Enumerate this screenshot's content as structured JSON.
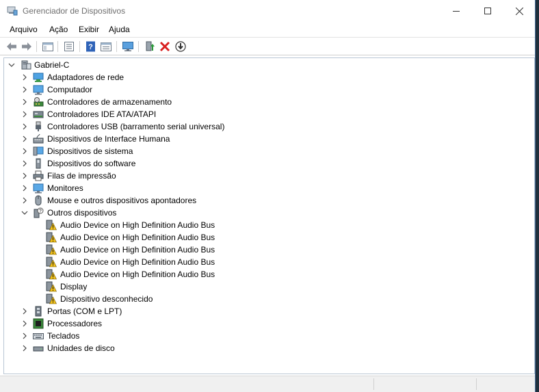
{
  "window": {
    "title": "Gerenciador de Dispositivos",
    "controls": {
      "minimize": "—",
      "maximize": "☐",
      "close": "✕"
    }
  },
  "menu": [
    "Arquivo",
    "Ação",
    "Exibir",
    "Ajuda"
  ],
  "toolbar": {
    "buttons": [
      "back-icon",
      "forward-icon",
      "properties-pane-icon",
      "properties-list-icon",
      "help-icon",
      "view-details-icon",
      "monitor-scan-icon",
      "update-driver-icon",
      "uninstall-icon",
      "disable-icon"
    ],
    "accent_colors": {
      "uninstall": "#d92020",
      "update": "#2a9a3a",
      "help": "#2f63b8"
    }
  },
  "tree": {
    "root": "Gabriel-C",
    "categories": [
      {
        "label": "Adaptadores de rede",
        "icon": "network-adapter-icon",
        "expanded": false
      },
      {
        "label": "Computador",
        "icon": "computer-icon",
        "expanded": false
      },
      {
        "label": "Controladores de armazenamento",
        "icon": "storage-controller-icon",
        "expanded": false
      },
      {
        "label": "Controladores IDE ATA/ATAPI",
        "icon": "ide-controller-icon",
        "expanded": false
      },
      {
        "label": "Controladores USB (barramento serial universal)",
        "icon": "usb-icon",
        "expanded": false
      },
      {
        "label": "Dispositivos de Interface Humana",
        "icon": "hid-icon",
        "expanded": false
      },
      {
        "label": "Dispositivos de sistema",
        "icon": "system-device-icon",
        "expanded": false
      },
      {
        "label": "Dispositivos do software",
        "icon": "software-device-icon",
        "expanded": false
      },
      {
        "label": "Filas de impressão",
        "icon": "printer-icon",
        "expanded": false
      },
      {
        "label": "Monitores",
        "icon": "monitor-icon",
        "expanded": false
      },
      {
        "label": "Mouse e outros dispositivos apontadores",
        "icon": "mouse-icon",
        "expanded": false
      },
      {
        "label": "Outros dispositivos",
        "icon": "other-devices-icon",
        "expanded": true,
        "children": [
          "Audio Device on High Definition Audio Bus",
          "Audio Device on High Definition Audio Bus",
          "Audio Device on High Definition Audio Bus",
          "Audio Device on High Definition Audio Bus",
          "Audio Device on High Definition Audio Bus",
          "Display",
          "Dispositivo desconhecido"
        ]
      },
      {
        "label": "Portas (COM e LPT)",
        "icon": "port-icon",
        "expanded": false
      },
      {
        "label": "Processadores",
        "icon": "processor-icon",
        "expanded": false
      },
      {
        "label": "Teclados",
        "icon": "keyboard-icon",
        "expanded": false
      },
      {
        "label": "Unidades de disco",
        "icon": "disk-drive-icon",
        "expanded": false
      }
    ]
  },
  "statusbar": {
    "text": ""
  }
}
